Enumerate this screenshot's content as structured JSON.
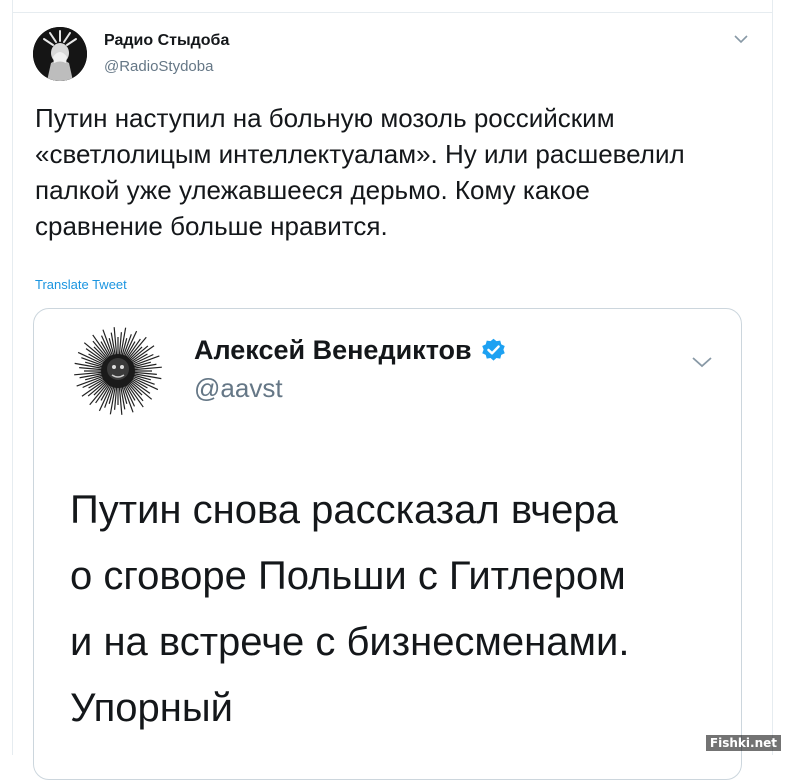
{
  "tweet": {
    "author_name": "Радио Стыдоба",
    "author_handle": "@RadioStydoba",
    "text": "Путин наступил на больную мозоль российским\n«светлолицым интеллектуалам». Ну или расшевелил\nпалкой уже улежавшееся дерьмо. Кому какое\nсравнение больше нравится.",
    "translate_label": "Translate Tweet",
    "icons": {
      "avatar": "statue-of-liberty-facepalm-avatar",
      "menu": "chevron-down-icon"
    }
  },
  "quoted_tweet": {
    "author_name": "Алексей Венедиктов",
    "author_handle": "@aavst",
    "text": "Путин снова рассказал вчера\nо сговоре Польши с Гитлером\nи на встрече с бизнесменами.\nУпорный",
    "icons": {
      "verified": "verified-badge-icon",
      "menu": "chevron-down-icon"
    }
  },
  "watermark": "Fishki.net",
  "colors": {
    "link": "#1b95e0",
    "secondary_text": "#657786",
    "border": "#ccd6dd",
    "verified": "#1da1f2"
  }
}
